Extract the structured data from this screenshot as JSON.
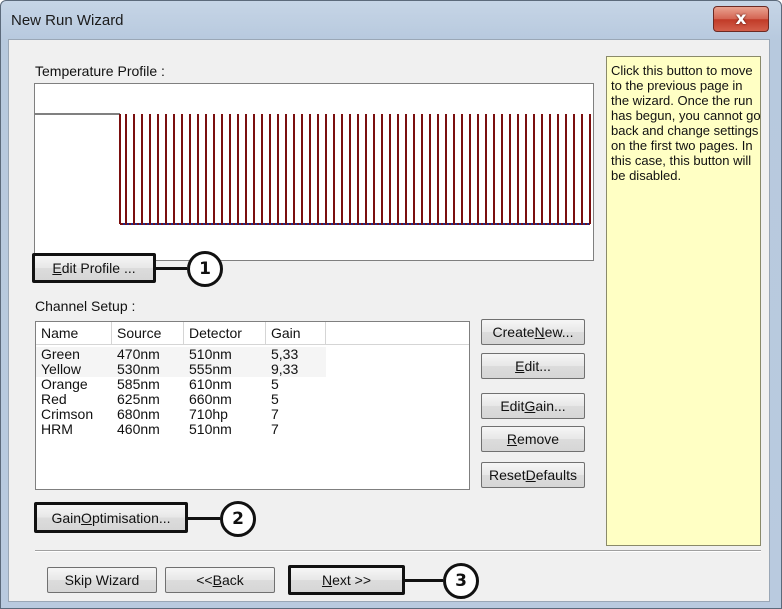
{
  "window": {
    "title": "New Run Wizard",
    "close_icon": "close-x-icon",
    "close_symbol": "x"
  },
  "temperature_profile": {
    "label": "Temperature Profile :",
    "edit_button": {
      "pre": "",
      "mnemonic": "E",
      "post": "dit Profile ..."
    },
    "callout": "1"
  },
  "channel_setup": {
    "label": "Channel Setup :",
    "columns": [
      "Name",
      "Source",
      "Detector",
      "Gain"
    ],
    "rows": [
      {
        "name": "Green",
        "source": "470nm",
        "detector": "510nm",
        "gain": "5,33"
      },
      {
        "name": "Yellow",
        "source": "530nm",
        "detector": "555nm",
        "gain": "9,33"
      },
      {
        "name": "Orange",
        "source": "585nm",
        "detector": "610nm",
        "gain": "5"
      },
      {
        "name": "Red",
        "source": "625nm",
        "detector": "660nm",
        "gain": "5"
      },
      {
        "name": "Crimson",
        "source": "680nm",
        "detector": "710hp",
        "gain": "7"
      },
      {
        "name": "HRM",
        "source": "460nm",
        "detector": "510nm",
        "gain": "7"
      }
    ],
    "buttons": {
      "create_new": {
        "pre": "Create ",
        "mnemonic": "N",
        "post": "ew..."
      },
      "edit": {
        "pre": "",
        "mnemonic": "E",
        "post": "dit..."
      },
      "edit_gain": {
        "pre": "Edit ",
        "mnemonic": "G",
        "post": "ain..."
      },
      "remove": {
        "pre": "",
        "mnemonic": "R",
        "post": "emove"
      },
      "reset_defaults": {
        "pre": "Reset ",
        "mnemonic": "D",
        "post": "efaults"
      }
    },
    "gain_optimisation": {
      "pre": "Gain ",
      "mnemonic": "O",
      "post": "ptimisation..."
    },
    "callout": "2"
  },
  "help_text": "Click this button to move to the previous page in the wizard. Once the run has begun, you cannot go back and change settings on the first two pages. In this case, this button will be disabled.",
  "footer": {
    "skip_wizard": "Skip Wizard",
    "back": {
      "pre": "<< ",
      "mnemonic": "B",
      "post": "ack"
    },
    "next": {
      "pre": "",
      "mnemonic": "N",
      "post": "ext >>"
    },
    "callout": "3"
  },
  "colors": {
    "profile_line": "#7a0f0f",
    "profile_dots": "#1c2a8a",
    "help_bg": "#ffffc4",
    "callout_border": "#111111"
  },
  "profile_pulse_count": 59
}
